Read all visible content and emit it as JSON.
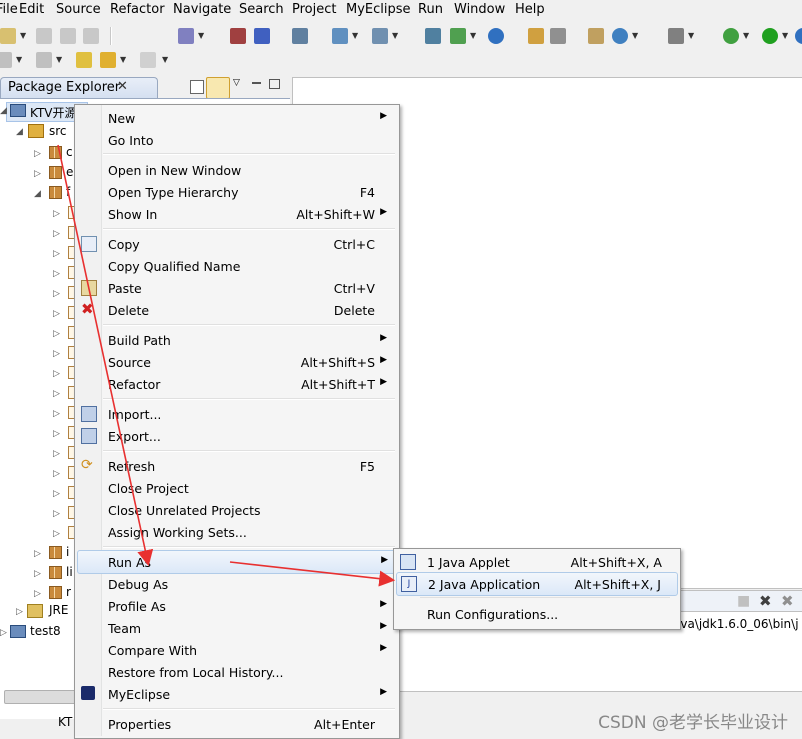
{
  "menubar": {
    "items": [
      "File",
      "Edit",
      "Source",
      "Refactor",
      "Navigate",
      "Search",
      "Project",
      "MyEclipse",
      "Run",
      "Window",
      "Help"
    ]
  },
  "package_explorer": {
    "title": "Package Explorer",
    "close_glyph": "✕",
    "tree": {
      "project": "KTV开源",
      "src": "src",
      "pkg_c": "c",
      "pkg_e": "e",
      "pkg_f": "f",
      "pkg_i": "i",
      "pkg_li": "li",
      "pkg_r": "r",
      "jre": "JRE",
      "test8": "test8"
    }
  },
  "console": {
    "path_text": "ava\\jdk1.6.0_06\\bin\\j"
  },
  "status": {
    "kt": "KT"
  },
  "context_menu": {
    "new": "New",
    "go_into": "Go Into",
    "open_new_window": "Open in New Window",
    "open_type_hierarchy": "Open Type Hierarchy",
    "open_type_hierarchy_sc": "F4",
    "show_in": "Show In",
    "show_in_sc": "Alt+Shift+W",
    "copy": "Copy",
    "copy_sc": "Ctrl+C",
    "copy_qualified": "Copy Qualified Name",
    "paste": "Paste",
    "paste_sc": "Ctrl+V",
    "delete": "Delete",
    "delete_sc": "Delete",
    "build_path": "Build Path",
    "source": "Source",
    "source_sc": "Alt+Shift+S",
    "refactor": "Refactor",
    "refactor_sc": "Alt+Shift+T",
    "import": "Import...",
    "export": "Export...",
    "refresh": "Refresh",
    "refresh_sc": "F5",
    "close_project": "Close Project",
    "close_unrelated": "Close Unrelated Projects",
    "assign_working_sets": "Assign Working Sets...",
    "run_as": "Run As",
    "debug_as": "Debug As",
    "profile_as": "Profile As",
    "team": "Team",
    "compare_with": "Compare With",
    "restore_history": "Restore from Local History...",
    "myeclipse": "MyEclipse",
    "properties": "Properties",
    "properties_sc": "Alt+Enter"
  },
  "run_as_submenu": {
    "java_applet": "1 Java Applet",
    "java_applet_sc": "Alt+Shift+X, A",
    "java_application": "2 Java Application",
    "java_application_sc": "Alt+Shift+X, J",
    "run_configurations": "Run Configurations..."
  },
  "watermark": "CSDN @老学长毕业设计",
  "colors": {
    "arrow": "#e83030",
    "highlight": "#dbe8f8",
    "package": "#c98a3c"
  }
}
